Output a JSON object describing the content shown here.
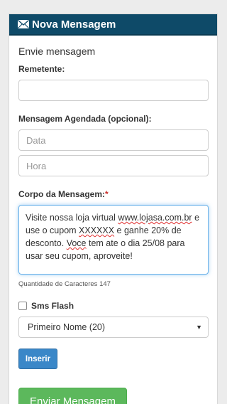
{
  "header": {
    "title": "Nova Mensagem",
    "icon": "envelope-icon"
  },
  "form": {
    "section_title": "Envie mensagem",
    "remetente_label": "Remetente:",
    "remetente_value": "",
    "agendada_label": "Mensagem Agendada (opcional):",
    "data_placeholder": "Data",
    "hora_placeholder": "Hora",
    "corpo_label": "Corpo da Mensagem:",
    "required_mark": "*",
    "corpo_parts": [
      "Visite nossa loja virtual ",
      "www.lojasa.com.br",
      " e use o cupom ",
      "XXXXXX",
      " e ganhe 20% de desconto. ",
      "Voce",
      " tem ate o dia 25/08 para usar seu cupom, ",
      "aproveite",
      "!"
    ],
    "counter_text": "Quantidade de Caracteres 147",
    "sms_flash_label": "Sms Flash",
    "sms_flash_checked": false,
    "select_value": "Primeiro Nome (20)",
    "insert_button": "Inserir",
    "send_button": "Enviar Mensagem"
  },
  "colors": {
    "header_bg": "#0e4a68",
    "insert_button": "#3a87c8",
    "send_button": "#5cb85c",
    "required": "#c9302c"
  }
}
